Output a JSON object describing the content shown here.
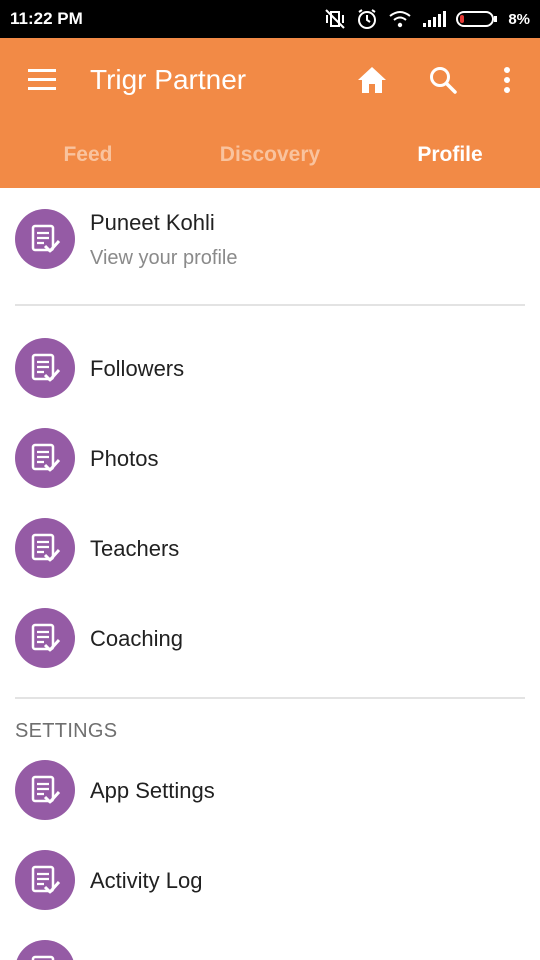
{
  "status_bar": {
    "time": "11:22 PM",
    "battery": "8%"
  },
  "app_bar": {
    "title": "Trigr Partner"
  },
  "tabs": [
    {
      "label": "Feed",
      "active": false
    },
    {
      "label": "Discovery",
      "active": false
    },
    {
      "label": "Profile",
      "active": true
    }
  ],
  "profile": {
    "name": "Puneet Kohli",
    "subtitle": "View your profile"
  },
  "menu_items": [
    {
      "label": "Followers"
    },
    {
      "label": "Photos"
    },
    {
      "label": "Teachers"
    },
    {
      "label": "Coaching"
    }
  ],
  "settings": {
    "header": "SETTINGS",
    "items": [
      {
        "label": "App Settings"
      },
      {
        "label": "Activity Log"
      }
    ]
  },
  "colors": {
    "app_bar": "#F28A46",
    "avatar": "#955BA5",
    "inactive_tab": "#F9C39E"
  },
  "icons": [
    "menu-icon",
    "home-icon",
    "search-icon",
    "more-vert-icon",
    "document-check-icon"
  ]
}
